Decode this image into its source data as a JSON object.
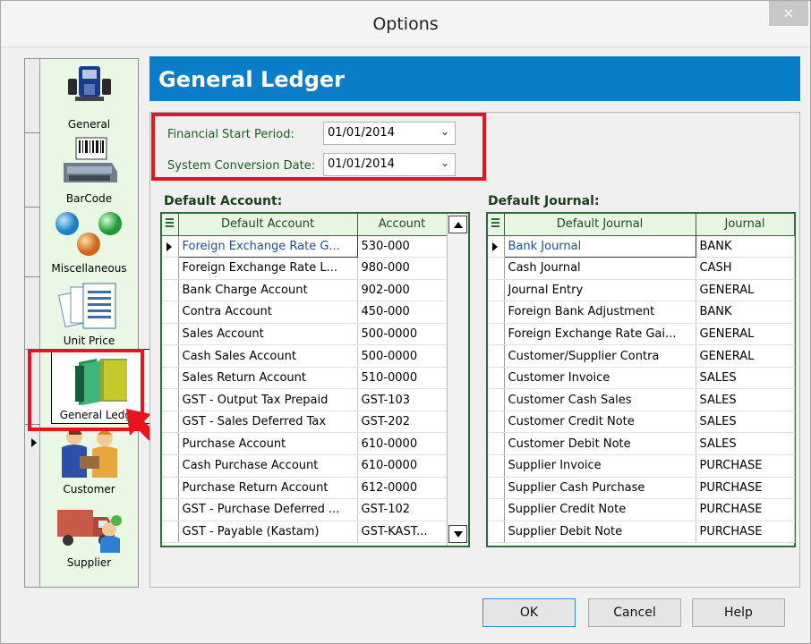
{
  "window": {
    "title": "Options",
    "close_glyph": "×"
  },
  "nav": {
    "items": [
      {
        "label": "General",
        "icon": "general-icon"
      },
      {
        "label": "BarCode",
        "icon": "barcode-printer-icon"
      },
      {
        "label": "Miscellaneous",
        "icon": "miscellaneous-icon"
      },
      {
        "label": "Unit Price",
        "icon": "unit-price-icon"
      },
      {
        "label": "General Ledger",
        "icon": "general-ledger-icon"
      },
      {
        "label": "Customer",
        "icon": "customer-icon"
      },
      {
        "label": "Supplier",
        "icon": "supplier-icon"
      }
    ],
    "selected": "General Ledger"
  },
  "header": {
    "title": "General Ledger"
  },
  "periods": {
    "financial_start_label": "Financial Start Period:",
    "financial_start_value": "01/01/2014",
    "conversion_label": "System Conversion Date:",
    "conversion_value": "01/01/2014"
  },
  "default_account": {
    "section_title": "Default Account:",
    "columns": [
      "Default Account",
      "Account"
    ],
    "rows": [
      {
        "name": "Foreign Exchange Rate G...",
        "account": "530-000"
      },
      {
        "name": "Foreign Exchange Rate L...",
        "account": "980-000"
      },
      {
        "name": "Bank Charge Account",
        "account": "902-000"
      },
      {
        "name": "Contra Account",
        "account": "450-000"
      },
      {
        "name": "Sales Account",
        "account": "500-0000"
      },
      {
        "name": "Cash Sales Account",
        "account": "500-0000"
      },
      {
        "name": "Sales Return Account",
        "account": "510-0000"
      },
      {
        "name": "GST - Output Tax Prepaid",
        "account": "GST-103"
      },
      {
        "name": "GST - Sales Deferred Tax",
        "account": "GST-202"
      },
      {
        "name": "Purchase Account",
        "account": "610-0000"
      },
      {
        "name": "Cash Purchase Account",
        "account": "610-0000"
      },
      {
        "name": "Purchase Return Account",
        "account": "612-0000"
      },
      {
        "name": "GST - Purchase Deferred ...",
        "account": "GST-102"
      },
      {
        "name": "GST - Payable (Kastam)",
        "account": "GST-KAST..."
      }
    ]
  },
  "default_journal": {
    "section_title": "Default Journal:",
    "columns": [
      "Default Journal",
      "Journal"
    ],
    "rows": [
      {
        "name": "Bank Journal",
        "journal": "BANK"
      },
      {
        "name": "Cash Journal",
        "journal": "CASH"
      },
      {
        "name": "Journal Entry",
        "journal": "GENERAL"
      },
      {
        "name": "Foreign Bank Adjustment",
        "journal": "BANK"
      },
      {
        "name": "Foreign Exchange Rate Gai...",
        "journal": "GENERAL"
      },
      {
        "name": "Customer/Supplier Contra",
        "journal": "GENERAL"
      },
      {
        "name": "Customer Invoice",
        "journal": "SALES"
      },
      {
        "name": "Customer Cash Sales",
        "journal": "SALES"
      },
      {
        "name": "Customer Credit Note",
        "journal": "SALES"
      },
      {
        "name": "Customer Debit Note",
        "journal": "SALES"
      },
      {
        "name": "Supplier Invoice",
        "journal": "PURCHASE"
      },
      {
        "name": "Supplier Cash Purchase",
        "journal": "PURCHASE"
      },
      {
        "name": "Supplier Credit Note",
        "journal": "PURCHASE"
      },
      {
        "name": "Supplier Debit Note",
        "journal": "PURCHASE"
      }
    ]
  },
  "buttons": {
    "ok": "OK",
    "cancel": "Cancel",
    "help": "Help"
  },
  "colors": {
    "accent": "#0a7dc8",
    "highlight": "#e8141b",
    "grid_border": "#2e6b39",
    "nav_background": "#e9f7e4"
  }
}
